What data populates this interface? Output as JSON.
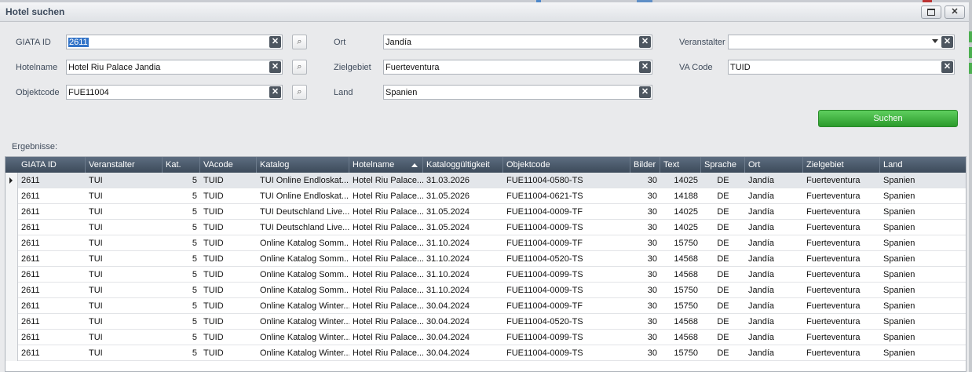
{
  "window": {
    "title": "Hotel suchen"
  },
  "form": {
    "giata_label": "GIATA ID",
    "giata_value": "2611",
    "hotelname_label": "Hotelname",
    "hotelname_value": "Hotel Riu Palace Jandia",
    "objektcode_label": "Objektcode",
    "objektcode_value": "FUE11004",
    "ort_label": "Ort",
    "ort_value": "Jandía",
    "zielgebiet_label": "Zielgebiet",
    "zielgebiet_value": "Fuerteventura",
    "land_label": "Land",
    "land_value": "Spanien",
    "veranstalter_label": "Veranstalter",
    "veranstalter_value": "",
    "vacode_label": "VA Code",
    "vacode_value": "TUID",
    "search_button": "Suchen",
    "clear_glyph": "✕",
    "search_icon": "magnifier-icon"
  },
  "results": {
    "label": "Ergebnisse:",
    "sorted_column": "Hotelname",
    "columns": [
      "GIATA ID",
      "Veranstalter",
      "Kat.",
      "VAcode",
      "Katalog",
      "Hotelname",
      "Kataloggültigkeit",
      "Objektcode",
      "Bilder",
      "Text",
      "Sprache",
      "Ort",
      "Zielgebiet",
      "Land"
    ],
    "rows": [
      [
        "2611",
        "TUI",
        "5",
        "TUID",
        "TUI Online Endloskat...",
        "Hotel Riu Palace...",
        "31.03.2026",
        "FUE11004-0580-TS",
        "30",
        "14025",
        "DE",
        "Jandía",
        "Fuerteventura",
        "Spanien"
      ],
      [
        "2611",
        "TUI",
        "5",
        "TUID",
        "TUI Online Endloskat...",
        "Hotel Riu Palace...",
        "31.05.2026",
        "FUE11004-0621-TS",
        "30",
        "14188",
        "DE",
        "Jandía",
        "Fuerteventura",
        "Spanien"
      ],
      [
        "2611",
        "TUI",
        "5",
        "TUID",
        "TUI Deutschland Live...",
        "Hotel Riu Palace...",
        "31.05.2024",
        "FUE11004-0009-TF",
        "30",
        "14025",
        "DE",
        "Jandía",
        "Fuerteventura",
        "Spanien"
      ],
      [
        "2611",
        "TUI",
        "5",
        "TUID",
        "TUI Deutschland Live...",
        "Hotel Riu Palace...",
        "31.05.2024",
        "FUE11004-0009-TS",
        "30",
        "14025",
        "DE",
        "Jandía",
        "Fuerteventura",
        "Spanien"
      ],
      [
        "2611",
        "TUI",
        "5",
        "TUID",
        "Online Katalog Somm...",
        "Hotel Riu Palace...",
        "31.10.2024",
        "FUE11004-0009-TF",
        "30",
        "15750",
        "DE",
        "Jandía",
        "Fuerteventura",
        "Spanien"
      ],
      [
        "2611",
        "TUI",
        "5",
        "TUID",
        "Online Katalog Somm...",
        "Hotel Riu Palace...",
        "31.10.2024",
        "FUE11004-0520-TS",
        "30",
        "14568",
        "DE",
        "Jandía",
        "Fuerteventura",
        "Spanien"
      ],
      [
        "2611",
        "TUI",
        "5",
        "TUID",
        "Online Katalog Somm...",
        "Hotel Riu Palace...",
        "31.10.2024",
        "FUE11004-0099-TS",
        "30",
        "14568",
        "DE",
        "Jandía",
        "Fuerteventura",
        "Spanien"
      ],
      [
        "2611",
        "TUI",
        "5",
        "TUID",
        "Online Katalog Somm...",
        "Hotel Riu Palace...",
        "31.10.2024",
        "FUE11004-0009-TS",
        "30",
        "15750",
        "DE",
        "Jandía",
        "Fuerteventura",
        "Spanien"
      ],
      [
        "2611",
        "TUI",
        "5",
        "TUID",
        "Online Katalog Winter...",
        "Hotel Riu Palace...",
        "30.04.2024",
        "FUE11004-0009-TF",
        "30",
        "15750",
        "DE",
        "Jandía",
        "Fuerteventura",
        "Spanien"
      ],
      [
        "2611",
        "TUI",
        "5",
        "TUID",
        "Online Katalog Winter...",
        "Hotel Riu Palace...",
        "30.04.2024",
        "FUE11004-0520-TS",
        "30",
        "14568",
        "DE",
        "Jandía",
        "Fuerteventura",
        "Spanien"
      ],
      [
        "2611",
        "TUI",
        "5",
        "TUID",
        "Online Katalog Winter...",
        "Hotel Riu Palace...",
        "30.04.2024",
        "FUE11004-0099-TS",
        "30",
        "14568",
        "DE",
        "Jandía",
        "Fuerteventura",
        "Spanien"
      ],
      [
        "2611",
        "TUI",
        "5",
        "TUID",
        "Online Katalog Winter...",
        "Hotel Riu Palace...",
        "30.04.2024",
        "FUE11004-0009-TS",
        "30",
        "15750",
        "DE",
        "Jandía",
        "Fuerteventura",
        "Spanien"
      ]
    ]
  },
  "colors": {
    "header_bg": "#4a5868",
    "search_green": "#3cb043",
    "selection_blue": "#3374c8"
  }
}
